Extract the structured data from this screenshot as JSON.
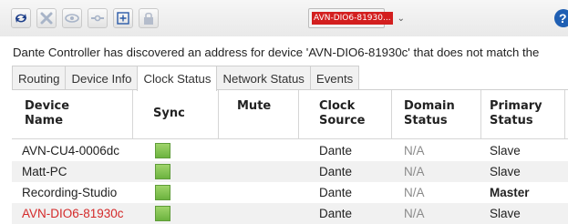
{
  "toolbar": {
    "buttons": [
      {
        "icon": "refresh-icon"
      },
      {
        "icon": "tools-icon"
      },
      {
        "icon": "eye-icon"
      },
      {
        "icon": "connect-icon"
      },
      {
        "icon": "plus-box-icon"
      },
      {
        "icon": "lock-icon"
      }
    ],
    "device_selector": {
      "value": "AVN-DIO6-81930..."
    },
    "help": {
      "icon": "help-icon",
      "label": "?"
    }
  },
  "message": "Dante Controller has discovered an address for device 'AVN-DIO6-81930c' that does not match the",
  "tabs": [
    {
      "label": "Routing",
      "active": false
    },
    {
      "label": "Device Info",
      "active": false
    },
    {
      "label": "Clock Status",
      "active": true
    },
    {
      "label": "Network Status",
      "active": false
    },
    {
      "label": "Events",
      "active": false
    }
  ],
  "table": {
    "headers": {
      "device_name_1": "Device",
      "device_name_2": "Name",
      "sync": "Sync",
      "mute": "Mute",
      "clock_source_1": "Clock",
      "clock_source_2": "Source",
      "domain_status_1": "Domain",
      "domain_status_2": "Status",
      "primary_status_1": "Primary",
      "primary_status_2": "Status"
    },
    "rows": [
      {
        "device": "AVN-CU4-0006dc",
        "sync": "green",
        "mute": "",
        "clock_source": "Dante",
        "domain_status": "N/A",
        "primary_status": "Slave"
      },
      {
        "device": "Matt-PC",
        "sync": "green",
        "mute": "",
        "clock_source": "Dante",
        "domain_status": "N/A",
        "primary_status": "Slave"
      },
      {
        "device": "Recording-Studio",
        "sync": "green",
        "mute": "",
        "clock_source": "Dante",
        "domain_status": "N/A",
        "primary_status": "Master"
      },
      {
        "device": "AVN-DIO6-81930c",
        "sync": "green",
        "mute": "",
        "clock_source": "Dante",
        "domain_status": "N/A",
        "primary_status": "Slave"
      }
    ]
  },
  "colors": {
    "sync_ok": "#7dc24b",
    "error_text": "#d42a2a",
    "device_tag_bg": "#d31f1f",
    "help_bg": "#1f5fb3"
  }
}
